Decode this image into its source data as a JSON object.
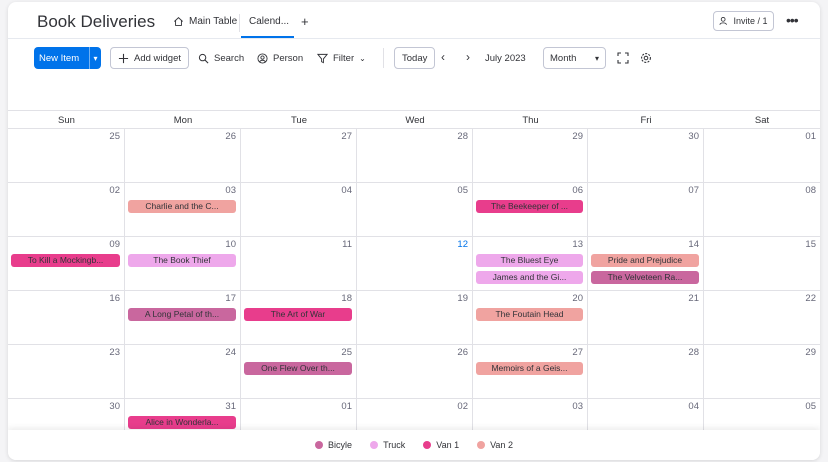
{
  "board": {
    "title": "Book Deliveries",
    "tabs": [
      {
        "label": "Main Table",
        "icon": "home-icon"
      },
      {
        "label": "Calend...",
        "active": true
      }
    ],
    "add_tab_label": "+",
    "invite_label": "Invite / 1",
    "more_label": "•••"
  },
  "toolbar": {
    "new_item_label": "New Item",
    "add_widget_label": "Add widget",
    "search_label": "Search",
    "person_label": "Person",
    "filter_label": "Filter",
    "today_label": "Today",
    "month_label": "July 2023",
    "view_mode": "Month"
  },
  "calendar": {
    "weekdays": [
      "Sun",
      "Mon",
      "Tue",
      "Wed",
      "Thu",
      "Fri",
      "Sat"
    ],
    "today": "12",
    "weeks": [
      {
        "days": [
          "25",
          "26",
          "27",
          "28",
          "29",
          "30",
          "01"
        ],
        "events": []
      },
      {
        "days": [
          "02",
          "03",
          "04",
          "05",
          "06",
          "07",
          "08"
        ],
        "events": [
          {
            "day": 1,
            "row": 0,
            "title": "Charlie and the C...",
            "vehicle": "Van 2"
          },
          {
            "day": 4,
            "row": 0,
            "title": "The Beekeeper of ...",
            "vehicle": "Van 1"
          }
        ]
      },
      {
        "days": [
          "09",
          "10",
          "11",
          "12",
          "13",
          "14",
          "15"
        ],
        "events": [
          {
            "day": 0,
            "row": 0,
            "title": "To Kill a Mockingb...",
            "vehicle": "Van 1"
          },
          {
            "day": 1,
            "row": 0,
            "title": "The Book Thief",
            "vehicle": "Truck"
          },
          {
            "day": 4,
            "row": 0,
            "title": "The Bluest Eye",
            "vehicle": "Truck"
          },
          {
            "day": 4,
            "row": 1,
            "title": "James and the Gi...",
            "vehicle": "Truck"
          },
          {
            "day": 5,
            "row": 0,
            "title": "Pride and Prejudice",
            "vehicle": "Van 2"
          },
          {
            "day": 5,
            "row": 1,
            "title": "The Velveteen Ra...",
            "vehicle": "Bicyle"
          }
        ]
      },
      {
        "days": [
          "16",
          "17",
          "18",
          "19",
          "20",
          "21",
          "22"
        ],
        "events": [
          {
            "day": 1,
            "row": 0,
            "title": "A Long Petal of th...",
            "vehicle": "Bicyle"
          },
          {
            "day": 2,
            "row": 0,
            "title": "The Art of War",
            "vehicle": "Van 1"
          },
          {
            "day": 4,
            "row": 0,
            "title": "The Foutain Head",
            "vehicle": "Van 2"
          }
        ]
      },
      {
        "days": [
          "23",
          "24",
          "25",
          "26",
          "27",
          "28",
          "29"
        ],
        "events": [
          {
            "day": 2,
            "row": 0,
            "title": "One Flew Over th...",
            "vehicle": "Bicyle"
          },
          {
            "day": 4,
            "row": 0,
            "title": "Memoirs of a Geis...",
            "vehicle": "Van 2"
          }
        ]
      },
      {
        "days": [
          "30",
          "31",
          "01",
          "02",
          "03",
          "04",
          "05"
        ],
        "events": [
          {
            "day": 1,
            "row": 0,
            "title": "Alice in Wonderla...",
            "vehicle": "Van 1"
          }
        ]
      }
    ]
  },
  "legend": [
    {
      "label": "Bicyle",
      "color": "#c9679e"
    },
    {
      "label": "Truck",
      "color": "#eea8eb"
    },
    {
      "label": "Van 1",
      "color": "#e83d8c"
    },
    {
      "label": "Van 2",
      "color": "#f0a3a0"
    }
  ]
}
